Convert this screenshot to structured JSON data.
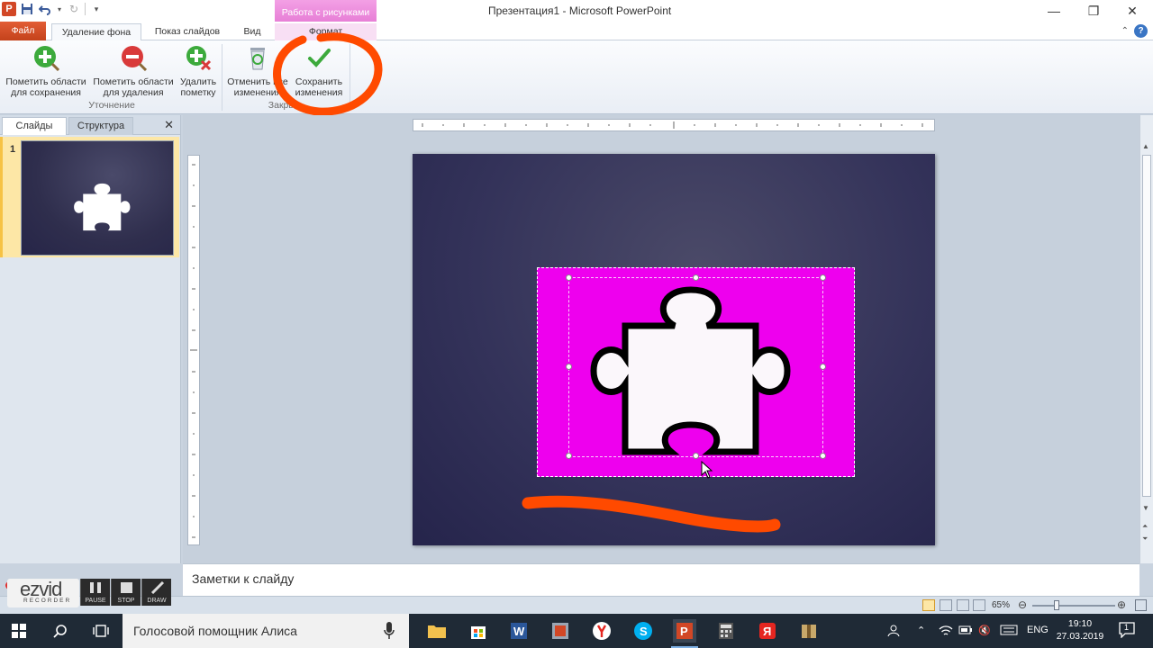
{
  "window": {
    "title": "Презентация1  -  Microsoft PowerPoint",
    "context_tab_header": "Работа с рисунками"
  },
  "tabs": [
    {
      "label": "Файл"
    },
    {
      "label": "Удаление фона"
    },
    {
      "label": "Показ слайдов"
    },
    {
      "label": "Вид"
    },
    {
      "label": "Формат"
    }
  ],
  "ribbon": {
    "mark_keep": "Пометить области\nдля сохранения",
    "mark_remove": "Пометить области\nдля удаления",
    "delete_mark": "Удалить\nпометку",
    "discard": "Отменить все\nизменения",
    "keep_changes": "Сохранить\nизменения",
    "group_refine": "Уточнение",
    "group_close": "Закрыть"
  },
  "left_pane": {
    "tab_slides": "Слайды",
    "tab_outline": "Структура",
    "slide_number": "1"
  },
  "notes_placeholder": "Заметки к слайду",
  "status": {
    "zoom": "65%"
  },
  "ezvid": {
    "logo": "ezvid",
    "sub": "RECORDER",
    "pause": "PAUSE",
    "stop": "STOP",
    "draw": "DRAW"
  },
  "taskbar": {
    "search": "Голосовой помощник Алиса",
    "lang": "ENG",
    "time": "19:10",
    "date": "27.03.2019",
    "notification_count": "1"
  },
  "colors": {
    "file_tab": "#c4421b",
    "context_tab": "#e77fd6",
    "remove_highlight": "#ee00ee",
    "annotation": "#ff4a00"
  }
}
